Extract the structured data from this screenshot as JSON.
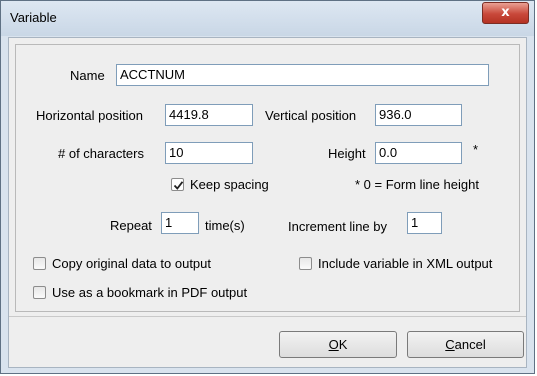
{
  "window": {
    "title": "Variable",
    "close_glyph": "x"
  },
  "form": {
    "name_label": "Name",
    "name_value": "ACCTNUM",
    "hpos_label": "Horizontal position",
    "hpos_value": "4419.8",
    "vpos_label": "Vertical position",
    "vpos_value": "936.0",
    "chars_label": "# of characters",
    "chars_value": "10",
    "height_label": "Height",
    "height_value": "0.0",
    "asterisk": "*",
    "keep_spacing_label": "Keep spacing",
    "keep_spacing_checked": true,
    "height_note": "* 0 = Form line height",
    "repeat_label": "Repeat",
    "repeat_value": "1",
    "repeat_unit": "time(s)",
    "increment_label": "Increment line by",
    "increment_value": "1",
    "copy_label": "Copy original data to output",
    "copy_checked": false,
    "xml_label": "Include variable in XML output",
    "xml_checked": false,
    "bookmark_label": "Use as a bookmark in PDF output",
    "bookmark_checked": false
  },
  "buttons": {
    "ok_mnemonic": "O",
    "ok_rest": "K",
    "cancel_mnemonic": "C",
    "cancel_rest": "ancel"
  }
}
